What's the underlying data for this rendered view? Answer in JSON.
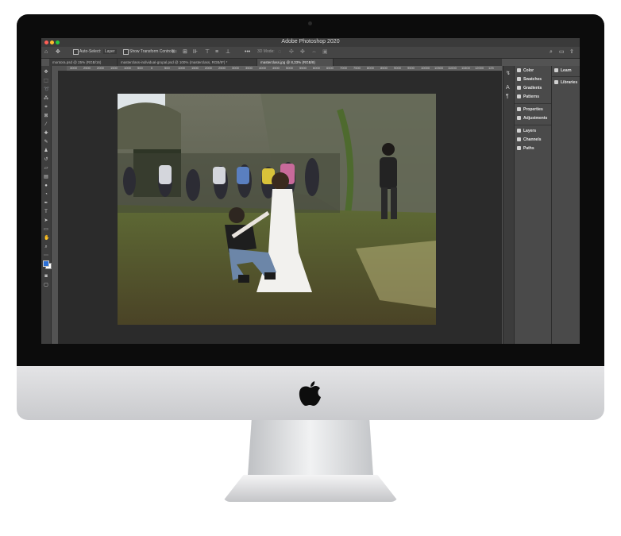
{
  "app": {
    "title": "Adobe Photoshop 2020"
  },
  "options_bar": {
    "auto_select_label": "Auto-Select:",
    "auto_select_value": "Layer",
    "transform_controls_label": "Show Transform Controls",
    "mode_3d_label": "3D Mode:"
  },
  "tabs": [
    {
      "label": "montora.psd @ 25% (RGB/16)"
    },
    {
      "label": "masterclass-individual-grupal.psd @ 100% (masterclass, RGB/8*) *"
    },
    {
      "label": "masterclass.jpg @ 8,33% (RGB/8)"
    }
  ],
  "ruler_labels": [
    "3000",
    "2500",
    "2000",
    "1500",
    "1000",
    "500",
    "0",
    "500",
    "1000",
    "1500",
    "2000",
    "2500",
    "3000",
    "3500",
    "4000",
    "4500",
    "5000",
    "5500",
    "6000",
    "6500",
    "7000",
    "7500",
    "8000",
    "8500",
    "9000",
    "9500",
    "10000",
    "10500",
    "11000",
    "11500",
    "12000",
    "125"
  ],
  "panels": {
    "group1": [
      "Color",
      "Swatches",
      "Gradients",
      "Patterns"
    ],
    "group2": [
      "Properties",
      "Adjustments"
    ],
    "group3": [
      "Layers",
      "Channels",
      "Paths"
    ],
    "secondary": [
      "Learn",
      "Libraries"
    ]
  },
  "colors": {
    "foreground_swatch": "#2b6fd6",
    "background_swatch": "#ffffff"
  }
}
